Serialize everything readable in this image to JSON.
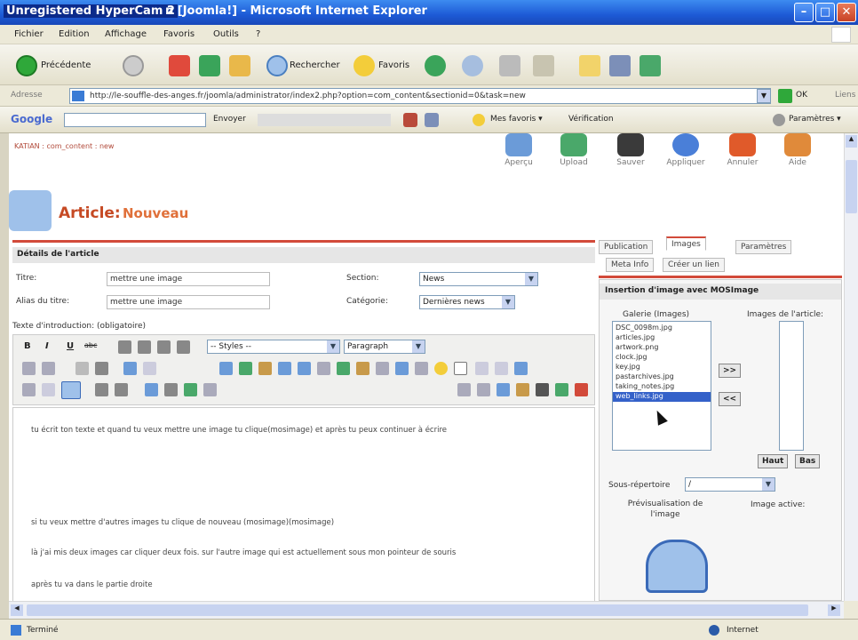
{
  "window": {
    "title_app": "Unregistered HyperCam 2",
    "title_page": "n [Joomla!] - Microsoft Internet Explorer",
    "min": "–",
    "max": "□",
    "close": "✕"
  },
  "menu": [
    "Fichier",
    "Edition",
    "Affichage",
    "Favoris",
    "Outils",
    "?"
  ],
  "toolbar": {
    "back": "Précédente",
    "search": "Rechercher",
    "favorites": "Favoris"
  },
  "address": {
    "label": "Adresse",
    "url": "http://le-souffle-des-anges.fr/joomla/administrator/index2.php?option=com_content&sectionid=0&task=new",
    "go": "OK",
    "links": "Liens"
  },
  "google": {
    "logo": "Google",
    "search_btn": "Envoyer",
    "favorites": "Mes favoris ▾",
    "check": "Vérification",
    "settings": "Paramètres ▾"
  },
  "breadcrumb": "KATIAN : com_content : new",
  "tools": [
    "Aperçu",
    "Upload",
    "Sauver",
    "Appliquer",
    "Annuler",
    "Aide"
  ],
  "page_title_prefix": "Article:",
  "page_title_suffix": "Nouveau",
  "details": {
    "header": "Détails de l'article",
    "title_label": "Titre:",
    "title_value": "mettre une image",
    "alias_label": "Alias du titre:",
    "alias_value": "mettre une image",
    "section_label": "Section:",
    "section_value": "News",
    "category_label": "Catégorie:",
    "category_value": "Dernières news",
    "intro_label": "Texte d'introduction: (obligatoire)"
  },
  "editor": {
    "bold": "B",
    "italic": "I",
    "underline": "U",
    "strike": "abc",
    "styles": "-- Styles --",
    "paragraph": "Paragraph"
  },
  "body_text": [
    "tu écrit ton texte et quand tu veux mettre une image tu clique(mosimage) et après tu peux continuer à écrire",
    "si tu veux mettre d'autres images tu clique de nouveau (mosimage)(mosimage)",
    "là j'ai mis deux images car cliquer deux fois. sur l'autre image qui est actuellement sous mon pointeur de souris",
    "après tu va dans le partie droite"
  ],
  "tabs_top": [
    "Publication",
    "Images",
    "Paramètres"
  ],
  "tabs_bottom": [
    "Meta Info",
    "Créer un lien"
  ],
  "images_panel": {
    "header": "Insertion d'image avec MOSImage",
    "gallery_label": "Galerie (Images)",
    "article_images_label": "Images de l'article:",
    "files": [
      "DSC_0098m.jpg",
      "articles.jpg",
      "artwork.png",
      "clock.jpg",
      "key.jpg",
      "pastarchives.jpg",
      "taking_notes.jpg",
      "web_links.jpg"
    ],
    "selected_index": 7,
    "add_btn": ">>",
    "remove_btn": "<<",
    "up_btn": "Haut",
    "down_btn": "Bas",
    "subfolder_label": "Sous-répertoire",
    "subfolder_value": "/",
    "preview_label": "Prévisualisation de l'image",
    "active_label": "Image active:"
  },
  "status": {
    "left": "Terminé",
    "right": "Internet"
  }
}
